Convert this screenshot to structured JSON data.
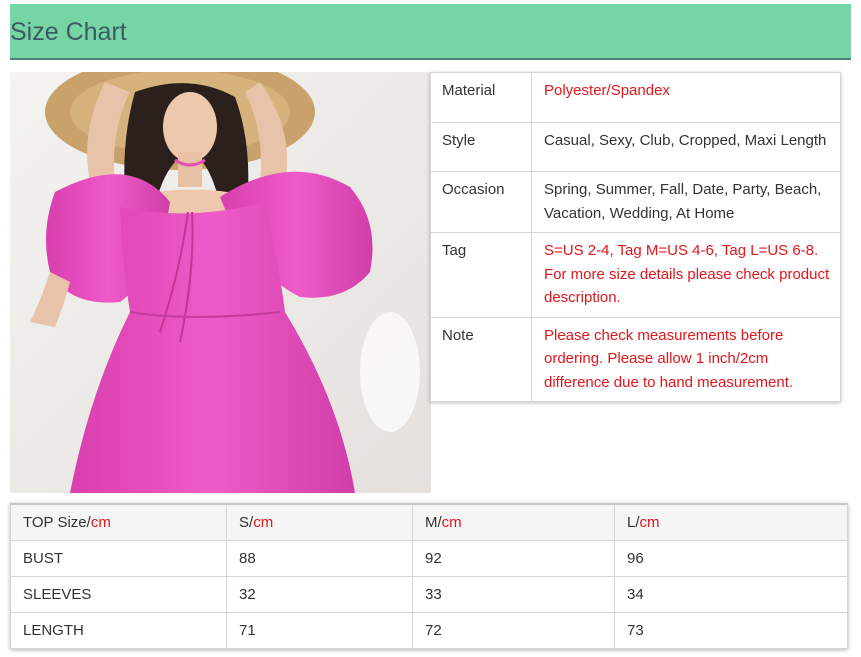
{
  "header": {
    "title": "Size Chart"
  },
  "product_image": {
    "alt": "Pink puff-sleeve dress with straw hat"
  },
  "specs": [
    {
      "key": "Material",
      "value": "Polyester/Spandex",
      "highlight": true
    },
    {
      "key": "Style",
      "value": "Casual, Sexy, Club, Cropped, Maxi Length",
      "highlight": false
    },
    {
      "key": "Occasion",
      "value": "Spring, Summer, Fall, Date, Party, Beach, Vacation, Wedding, At Home",
      "highlight": false
    },
    {
      "key": "Tag",
      "value": "S=US 2-4, Tag M=US 4-6, Tag L=US 6-8. For more size details please check product description.",
      "highlight": true
    },
    {
      "key": "Note",
      "value": "Please check measurements before ordering. Please allow 1 inch/2cm difference due to hand measurement.",
      "highlight": true
    }
  ],
  "size_table": {
    "headers": [
      {
        "label": "TOP Size/",
        "unit": "cm"
      },
      {
        "label": "S/",
        "unit": "cm"
      },
      {
        "label": "M/",
        "unit": "cm"
      },
      {
        "label": "L/",
        "unit": "cm"
      }
    ],
    "rows": [
      [
        "BUST",
        "88",
        "92",
        "96"
      ],
      [
        "SLEEVES",
        "32",
        "33",
        "34"
      ],
      [
        "LENGTH",
        "71",
        "72",
        "73"
      ]
    ]
  },
  "colors": {
    "header_bg": "#76d5a4",
    "accent_red": "#e0161b",
    "dress_pink": "#e84fc0"
  }
}
